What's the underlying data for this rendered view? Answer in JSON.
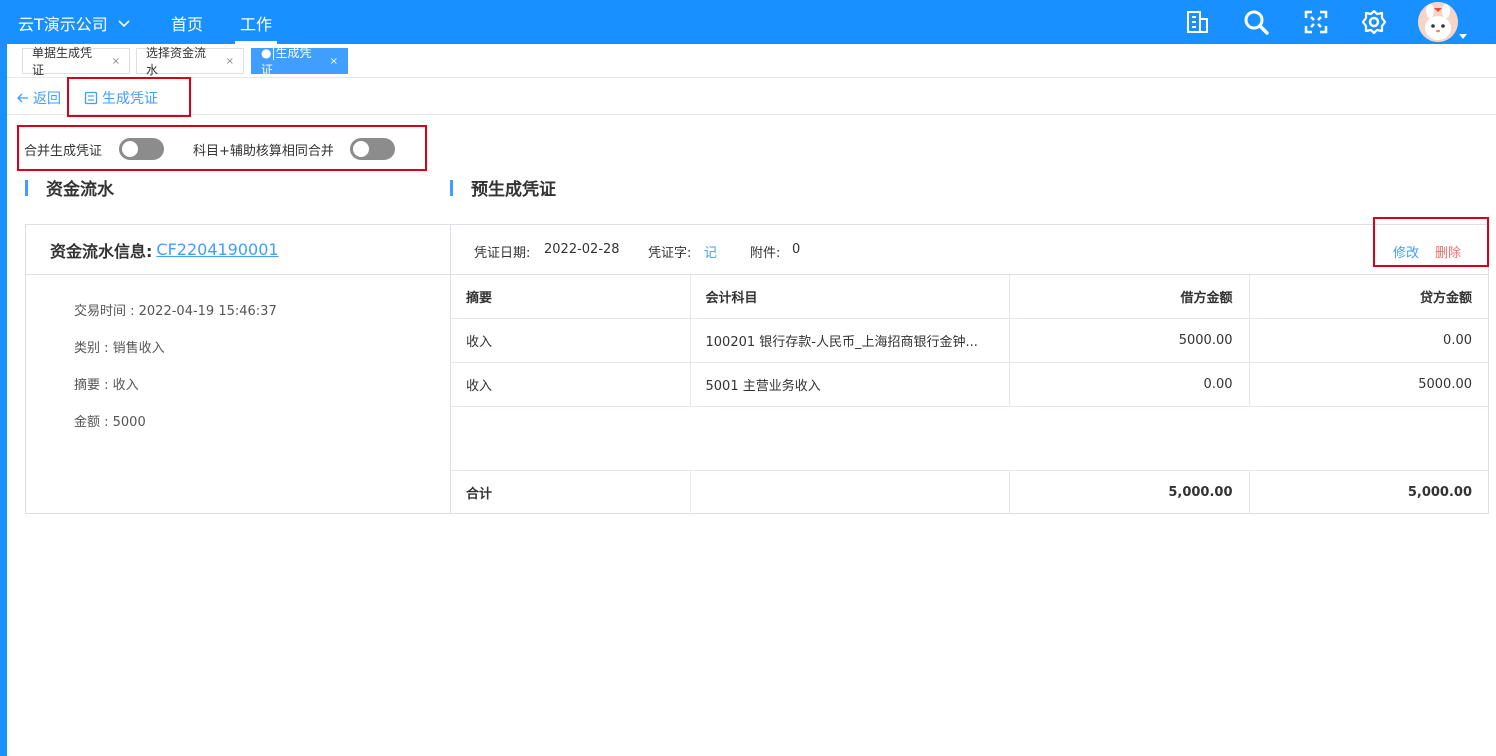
{
  "header": {
    "company": "云T演示公司",
    "nav": [
      "首页",
      "工作"
    ],
    "icons": [
      "building-icon",
      "search-icon",
      "fullscreen-icon",
      "gear-icon",
      "avatar"
    ]
  },
  "tabs": [
    {
      "label": "单据生成凭证",
      "close": "×"
    },
    {
      "label": "选择资金流水",
      "close": "×"
    },
    {
      "label": "●|生成凭证",
      "close": "×"
    }
  ],
  "actions": {
    "back": "返回",
    "generate": "生成凭证"
  },
  "options": {
    "merge": "合并生成凭证",
    "merge_same": "科目+辅助核算相同合并"
  },
  "sections": {
    "left": "资金流水",
    "right": "预生成凭证"
  },
  "flow": {
    "title": "资金流水信息:",
    "id": "CF2204190001",
    "lines": [
      "交易时间 : 2022-04-19 15:46:37",
      "类别 : 销售收入",
      "摘要 : 收入",
      "金额 : 5000"
    ]
  },
  "voucher": {
    "date_label": "凭证日期:",
    "date": "2022-02-28",
    "word_label": "凭证字:",
    "word": "记",
    "attach_label": "附件:",
    "attach": "0",
    "edit": "修改",
    "delete": "删除",
    "columns": [
      "摘要",
      "会计科目",
      "借方金额",
      "贷方金额"
    ],
    "rows": [
      [
        "收入",
        "100201 银行存款-人民币_上海招商银行金钟...",
        "5000.00",
        "0.00"
      ],
      [
        "收入",
        "5001 主营业务收入",
        "0.00",
        "5000.00"
      ]
    ],
    "total": [
      "合计",
      "",
      "5,000.00",
      "5,000.00"
    ]
  },
  "colors": {
    "primary": "#1890ff",
    "link": "#409eff",
    "danger": "#f56c6c",
    "highlight": "#d9001b"
  }
}
